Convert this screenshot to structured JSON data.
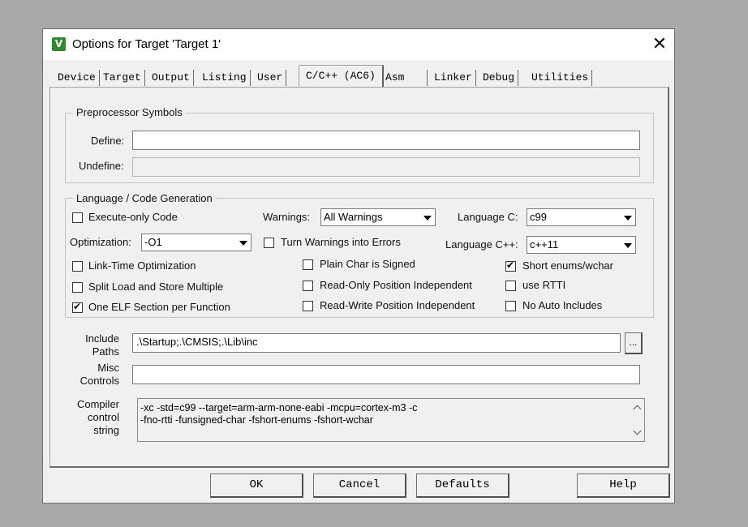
{
  "window": {
    "title": "Options for Target 'Target 1'",
    "close_glyph": "✕",
    "app_icon_glyph": "V"
  },
  "tabs": [
    "Device",
    "Target",
    "Output",
    "Listing",
    "User",
    "C/C++ (AC6)",
    "Asm",
    "Linker",
    "Debug",
    "Utilities"
  ],
  "active_tab": "C/C++ (AC6)",
  "preprocessor": {
    "legend": "Preprocessor Symbols",
    "define_label": "Define:",
    "define_value": "",
    "undefine_label": "Undefine:",
    "undefine_value": ""
  },
  "codegen": {
    "legend": "Language / Code Generation",
    "execute_only": {
      "label": "Execute-only Code",
      "checked": false
    },
    "warnings_label": "Warnings:",
    "warnings_value": "All Warnings",
    "language_c_label": "Language C:",
    "language_c_value": "c99",
    "optimization_label": "Optimization:",
    "optimization_value": "-O1",
    "turn_warnings_errors": {
      "label": "Turn Warnings into Errors",
      "checked": false
    },
    "language_cpp_label": "Language C++:",
    "language_cpp_value": "c++11",
    "link_time_opt": {
      "label": "Link-Time Optimization",
      "checked": false
    },
    "plain_char_signed": {
      "label": "Plain Char is Signed",
      "checked": false
    },
    "short_enums": {
      "label": "Short enums/wchar",
      "checked": true
    },
    "split_load_store": {
      "label": "Split Load and Store Multiple",
      "checked": false
    },
    "ro_pos_indep": {
      "label": "Read-Only Position Independent",
      "checked": false
    },
    "use_rtti": {
      "label": "use RTTI",
      "checked": false
    },
    "one_elf_section": {
      "label": "One ELF Section per Function",
      "checked": true
    },
    "rw_pos_indep": {
      "label": "Read-Write Position Independent",
      "checked": false
    },
    "no_auto_includes": {
      "label": "No Auto Includes",
      "checked": false
    }
  },
  "include_paths": {
    "label_line1": "Include",
    "label_line2": "Paths",
    "value": ".\\Startup;.\\CMSIS;.\\Lib\\inc",
    "browse_label": "..."
  },
  "misc_controls": {
    "label_line1": "Misc",
    "label_line2": "Controls",
    "value": ""
  },
  "compiler_control": {
    "label_line1": "Compiler",
    "label_line2": "control",
    "label_line3": "string",
    "line1": "-xc -std=c99 --target=arm-arm-none-eabi -mcpu=cortex-m3 -c",
    "line2": "-fno-rtti -funsigned-char -fshort-enums -fshort-wchar"
  },
  "buttons": {
    "ok": "OK",
    "cancel": "Cancel",
    "defaults": "Defaults",
    "help": "Help"
  }
}
